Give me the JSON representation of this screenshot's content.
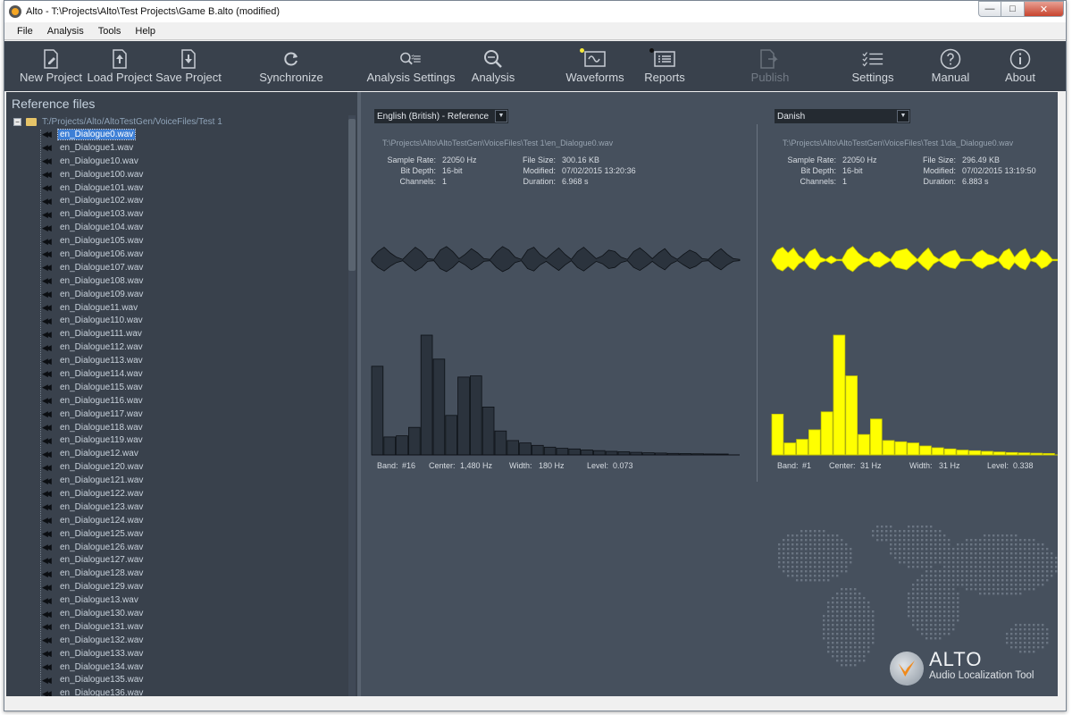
{
  "window": {
    "title": "Alto - T:\\Projects\\Alto\\Test Projects\\Game B.alto (modified)"
  },
  "window_buttons": {
    "minimize": "—",
    "maximize": "□",
    "close": "✕"
  },
  "menu": [
    "File",
    "Analysis",
    "Tools",
    "Help"
  ],
  "toolbar": {
    "new_project": {
      "label": "New Project",
      "icon": "new-document-icon"
    },
    "load_project": {
      "label": "Load Project",
      "icon": "upload-icon"
    },
    "save_project": {
      "label": "Save Project",
      "icon": "download-icon"
    },
    "synchronize": {
      "label": "Synchronize",
      "icon": "refresh-icon"
    },
    "analysis_settings": {
      "label": "Analysis Settings",
      "icon": "search-list-icon"
    },
    "analysis": {
      "label": "Analysis",
      "icon": "magnifier-icon"
    },
    "waveforms": {
      "label": "Waveforms",
      "icon": "waveform-icon",
      "indicator": "#f5e83a"
    },
    "reports": {
      "label": "Reports",
      "icon": "report-icon",
      "indicator": "#111111"
    },
    "publish": {
      "label": "Publish",
      "icon": "publish-icon",
      "enabled": false
    },
    "settings": {
      "label": "Settings",
      "icon": "checklist-icon"
    },
    "manual": {
      "label": "Manual",
      "icon": "question-icon"
    },
    "about": {
      "label": "About",
      "icon": "info-icon"
    }
  },
  "reference": {
    "title": "Reference files",
    "root_path": "T:/Projects/Alto/AltoTestGen/VoiceFiles/Test 1",
    "root_expander": "−",
    "selected": "en_Dialogue0.wav",
    "files": [
      "en_Dialogue0.wav",
      "en_Dialogue1.wav",
      "en_Dialogue10.wav",
      "en_Dialogue100.wav",
      "en_Dialogue101.wav",
      "en_Dialogue102.wav",
      "en_Dialogue103.wav",
      "en_Dialogue104.wav",
      "en_Dialogue105.wav",
      "en_Dialogue106.wav",
      "en_Dialogue107.wav",
      "en_Dialogue108.wav",
      "en_Dialogue109.wav",
      "en_Dialogue11.wav",
      "en_Dialogue110.wav",
      "en_Dialogue111.wav",
      "en_Dialogue112.wav",
      "en_Dialogue113.wav",
      "en_Dialogue114.wav",
      "en_Dialogue115.wav",
      "en_Dialogue116.wav",
      "en_Dialogue117.wav",
      "en_Dialogue118.wav",
      "en_Dialogue119.wav",
      "en_Dialogue12.wav",
      "en_Dialogue120.wav",
      "en_Dialogue121.wav",
      "en_Dialogue122.wav",
      "en_Dialogue123.wav",
      "en_Dialogue124.wav",
      "en_Dialogue125.wav",
      "en_Dialogue126.wav",
      "en_Dialogue127.wav",
      "en_Dialogue128.wav",
      "en_Dialogue129.wav",
      "en_Dialogue13.wav",
      "en_Dialogue130.wav",
      "en_Dialogue131.wav",
      "en_Dialogue132.wav",
      "en_Dialogue133.wav",
      "en_Dialogue134.wav",
      "en_Dialogue135.wav",
      "en_Dialogue136.wav"
    ]
  },
  "labels": {
    "sample_rate": "Sample Rate:",
    "bit_depth": "Bit Depth:",
    "channels": "Channels:",
    "file_size": "File Size:",
    "modified": "Modified:",
    "duration": "Duration:",
    "band": "Band:",
    "center": "Center:",
    "width": "Width:",
    "level": "Level:"
  },
  "left_audio": {
    "language": "English (British) - Reference",
    "path": "T:\\Projects\\Alto\\AltoTestGen\\VoiceFiles\\Test 1\\en_Dialogue0.wav",
    "sample_rate": "22050 Hz",
    "bit_depth": "16-bit",
    "channels": "1",
    "file_size": "300.16 KB",
    "modified": "07/02/2015 13:20:36",
    "duration": "6.968 s",
    "band": "#16",
    "center": "1,480 Hz",
    "width": "180 Hz",
    "level": "0.073",
    "color": "#2b333d",
    "stroke": "#0d1116",
    "spectrum": [
      0.74,
      0.15,
      0.16,
      0.23,
      1.0,
      0.8,
      0.33,
      0.65,
      0.66,
      0.4,
      0.2,
      0.12,
      0.1,
      0.08,
      0.065,
      0.055,
      0.05,
      0.042,
      0.036,
      0.03,
      0.026,
      0.022,
      0.018,
      0.016,
      0.013,
      0.011,
      0.01,
      0.008,
      0.007,
      0.006
    ],
    "envelope": [
      0.1,
      0.6,
      0.9,
      0.5,
      0.2,
      0.05,
      0.5,
      0.9,
      0.6,
      0.1,
      0.05,
      0.7,
      0.95,
      0.6,
      0.1,
      0.4,
      0.8,
      0.5,
      0.1,
      0.05,
      0.6,
      0.95,
      0.7,
      0.2,
      0.05,
      0.7,
      0.9,
      0.4,
      0.1,
      0.5,
      0.85,
      0.4,
      0.05,
      0.6,
      0.9,
      0.5,
      0.1,
      0.3,
      0.7,
      0.6,
      0.2,
      0.05,
      0.6,
      0.85,
      0.5,
      0.1,
      0.5,
      0.8,
      0.3,
      0.05,
      0.4,
      0.7,
      0.5,
      0.1,
      0.05,
      0.5,
      0.8,
      0.4,
      0.1,
      0.05
    ]
  },
  "right_audio": {
    "language": "Danish",
    "path": "T:\\Projects\\Alto\\AltoTestGen\\VoiceFiles\\Test 1\\da_Dialogue0.wav",
    "sample_rate": "22050 Hz",
    "bit_depth": "16-bit",
    "channels": "1",
    "file_size": "296.49 KB",
    "modified": "07/02/2015 13:19:50",
    "duration": "6.883 s",
    "band": "#1",
    "center": "31 Hz",
    "width": "31 Hz",
    "level": "0.338",
    "color": "#ffff00",
    "stroke": "#c8c800",
    "spectrum": [
      0.34,
      0.1,
      0.13,
      0.21,
      0.36,
      1.0,
      0.66,
      0.17,
      0.3,
      0.12,
      0.11,
      0.1,
      0.075,
      0.06,
      0.05,
      0.04,
      0.035,
      0.03,
      0.025,
      0.02,
      0.017,
      0.014,
      0.012,
      0.01,
      0.008,
      0.007,
      0.006,
      0.005,
      0.004,
      0.004
    ],
    "envelope": [
      0.05,
      0.7,
      0.9,
      0.5,
      0.85,
      0.3,
      0.05,
      0.6,
      0.8,
      0.2,
      0.05,
      0.3,
      0.05,
      0.05,
      0.7,
      0.95,
      0.5,
      0.2,
      0.05,
      0.5,
      0.6,
      0.3,
      0.05,
      0.6,
      0.7,
      0.8,
      0.4,
      0.05,
      0.5,
      0.85,
      0.3,
      0.05,
      0.4,
      0.6,
      0.7,
      0.1,
      0.05,
      0.05,
      0.5,
      0.7,
      0.4,
      0.3,
      0.05,
      0.6,
      0.8,
      0.2,
      0.6,
      0.8,
      0.05,
      0.2,
      0.7,
      0.5,
      0.05,
      0.05
    ]
  },
  "branding": {
    "name": "ALTO",
    "tagline": "Audio Localization Tool"
  }
}
